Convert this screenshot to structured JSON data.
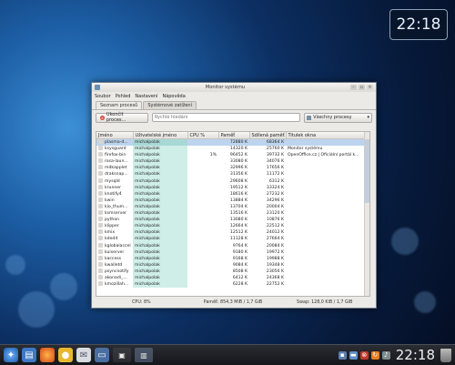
{
  "desktop_clock": "22:18",
  "window": {
    "title": "Monitor systému",
    "menu": [
      "Soubor",
      "Pohled",
      "Nastavení",
      "Nápověda"
    ],
    "tabs": [
      "Seznam procesů",
      "Systémové zatížení"
    ],
    "kill_button": "Ukončit proces...",
    "search_placeholder": "Rychlé hledání",
    "filter_value": "Všechny procesy",
    "columns": [
      "Jméno",
      "Uživatelské jméno",
      "CPU %",
      "Paměť",
      "Sdílená paměť",
      "Titulek okna"
    ],
    "rows": [
      {
        "name": "plasma-d...",
        "user": "michalpolak",
        "cpu": "",
        "mem": "72880 K",
        "shared": "68364 K",
        "title": "",
        "selected": true
      },
      {
        "name": "ksysguard",
        "user": "michalpolak",
        "cpu": "",
        "mem": "14320 K",
        "shared": "25760 K",
        "title": "Monitor systému"
      },
      {
        "name": "firefox-bin",
        "user": "michalpolak",
        "cpu": "1%",
        "mem": "96452 K",
        "shared": "39732 K",
        "title": "OpenOffice.cz | Oficiální portál k..."
      },
      {
        "name": "rosa-laun...",
        "user": "michalpolak",
        "cpu": "",
        "mem": "33080 K",
        "shared": "34076 K",
        "title": ""
      },
      {
        "name": "mdkapplet",
        "user": "michalpolak",
        "cpu": "",
        "mem": "32996 K",
        "shared": "17656 K",
        "title": ""
      },
      {
        "name": "draksnap...",
        "user": "michalpolak",
        "cpu": "",
        "mem": "31356 K",
        "shared": "11172 K",
        "title": ""
      },
      {
        "name": "mysqld",
        "user": "michalpolak",
        "cpu": "",
        "mem": "29608 K",
        "shared": "6312 K",
        "title": ""
      },
      {
        "name": "krunner",
        "user": "michalpolak",
        "cpu": "",
        "mem": "19512 K",
        "shared": "33324 K",
        "title": ""
      },
      {
        "name": "knotify4",
        "user": "michalpolak",
        "cpu": "",
        "mem": "18616 K",
        "shared": "27232 K",
        "title": ""
      },
      {
        "name": "kwin",
        "user": "michalpolak",
        "cpu": "",
        "mem": "13884 K",
        "shared": "34296 K",
        "title": ""
      },
      {
        "name": "kio_thum...",
        "user": "michalpolak",
        "cpu": "",
        "mem": "13704 K",
        "shared": "20004 K",
        "title": ""
      },
      {
        "name": "ksmserver",
        "user": "michalpolak",
        "cpu": "",
        "mem": "13516 K",
        "shared": "23120 K",
        "title": ""
      },
      {
        "name": "python",
        "user": "michalpolak",
        "cpu": "",
        "mem": "13080 K",
        "shared": "10876 K",
        "title": ""
      },
      {
        "name": "klipper",
        "user": "michalpolak",
        "cpu": "",
        "mem": "12664 K",
        "shared": "22512 K",
        "title": ""
      },
      {
        "name": "kmix",
        "user": "michalpolak",
        "cpu": "",
        "mem": "12512 K",
        "shared": "24012 K",
        "title": ""
      },
      {
        "name": "kded4",
        "user": "michalpolak",
        "cpu": "",
        "mem": "11128 K",
        "shared": "27664 K",
        "title": ""
      },
      {
        "name": "kglobalaccel",
        "user": "michalpolak",
        "cpu": "",
        "mem": "9764 K",
        "shared": "20084 K",
        "title": ""
      },
      {
        "name": "kuiserver",
        "user": "michalpolak",
        "cpu": "",
        "mem": "9180 K",
        "shared": "19972 K",
        "title": ""
      },
      {
        "name": "kaccess",
        "user": "michalpolak",
        "cpu": "",
        "mem": "9168 K",
        "shared": "19988 K",
        "title": ""
      },
      {
        "name": "kwalletd",
        "user": "michalpolak",
        "cpu": "",
        "mem": "9084 K",
        "shared": "19348 K",
        "title": ""
      },
      {
        "name": "psyncnotify",
        "user": "michalpolak",
        "cpu": "",
        "mem": "8508 K",
        "shared": "23056 K",
        "title": ""
      },
      {
        "name": "akonadi_...",
        "user": "michalpolak",
        "cpu": "",
        "mem": "6412 K",
        "shared": "24368 K",
        "title": ""
      },
      {
        "name": "kmozillah...",
        "user": "michalpolak",
        "cpu": "",
        "mem": "6228 K",
        "shared": "22752 K",
        "title": ""
      }
    ],
    "status": {
      "cpu": "CPU: 8%",
      "memory": "Paměť: 854,3 MiB / 1,7 GiB",
      "swap": "Swap: 128,0 KiB / 1,7 GiB"
    }
  },
  "taskbar": {
    "clock": "22:18",
    "launchers": [
      "rosa-menu-icon",
      "files-icon",
      "firefox-icon",
      "chat-icon",
      "mail-icon",
      "desktop-icon",
      "terminal-icon",
      "monitor-icon"
    ],
    "tray": [
      "devices-icon",
      "folder-icon",
      "network-icon",
      "update-icon",
      "volume-icon",
      "battery-icon"
    ]
  }
}
